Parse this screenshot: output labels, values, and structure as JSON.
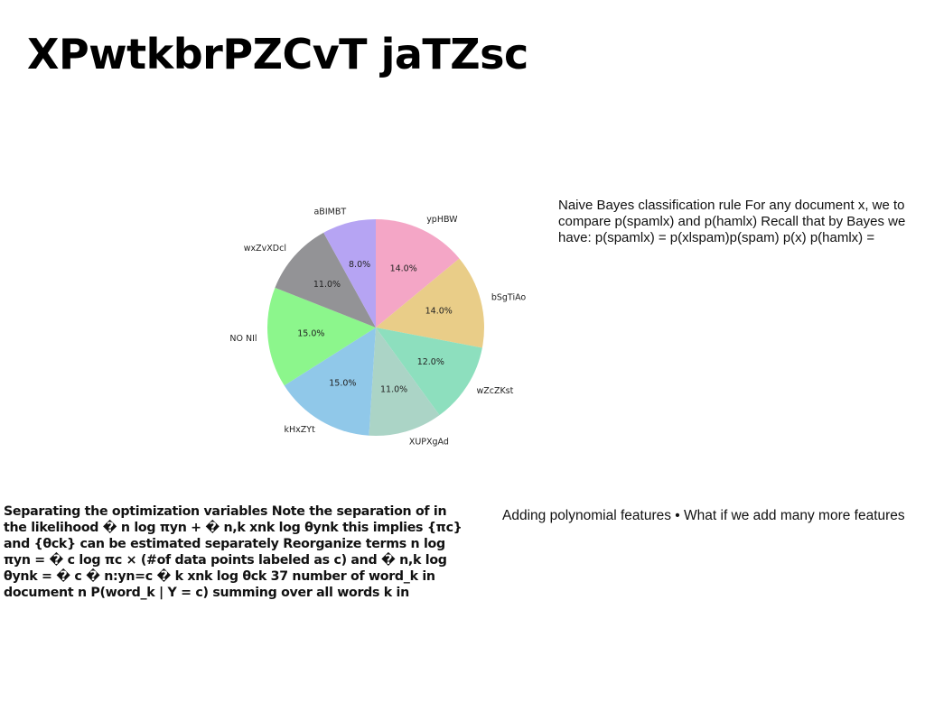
{
  "page": {
    "title": "XPwtkbrPZCvT jaTZsc"
  },
  "blocks": {
    "naive_bayes": "Naive Bayes classification rule For any document x, we to compare p(spamlx) and p(hamlx) Recall that by Bayes we have: p(spamlx) = p(xlspam)p(spam) p(x) p(hamlx) =",
    "separating": "Separating the optimization variables Note the separation of in the likelihood � n log πyn + � n,k xnk log θynk this implies {πc} and {θck} can be estimated separately Reorganize terms n log πyn = � c log πc × (#of data points labeled as c) and � n,k log θynk = � c � n:yn=c � k xnk log θck 37 number of word_k in document n P(word_k | Y = c) summing over all words k in",
    "polynomial": "Adding polynomial features • What if we add many more features"
  },
  "chart_data": {
    "type": "pie",
    "title": "",
    "start_angle_deg": 90,
    "direction": "clockwise",
    "slices": [
      {
        "label": "ypHBW",
        "value": 14.0,
        "pct_label": "14.0%",
        "color": "#f4a6c6"
      },
      {
        "label": "bSgTiAo",
        "value": 14.0,
        "pct_label": "14.0%",
        "color": "#e9cd88"
      },
      {
        "label": "wZcZKst",
        "value": 12.0,
        "pct_label": "12.0%",
        "color": "#8ddfbe"
      },
      {
        "label": "XUPXgAd",
        "value": 11.0,
        "pct_label": "11.0%",
        "color": "#abd4c6"
      },
      {
        "label": "kHxZYt",
        "value": 15.0,
        "pct_label": "15.0%",
        "color": "#90c8e9"
      },
      {
        "label": "NO NIl",
        "value": 15.0,
        "pct_label": "15.0%",
        "color": "#8cf68c"
      },
      {
        "label": "wxZvXDcl",
        "value": 11.0,
        "pct_label": "11.0%",
        "color": "#939396"
      },
      {
        "label": "aBIMBT",
        "value": 8.0,
        "pct_label": "8.0%",
        "color": "#b6a4f3"
      }
    ],
    "legend": "none"
  }
}
